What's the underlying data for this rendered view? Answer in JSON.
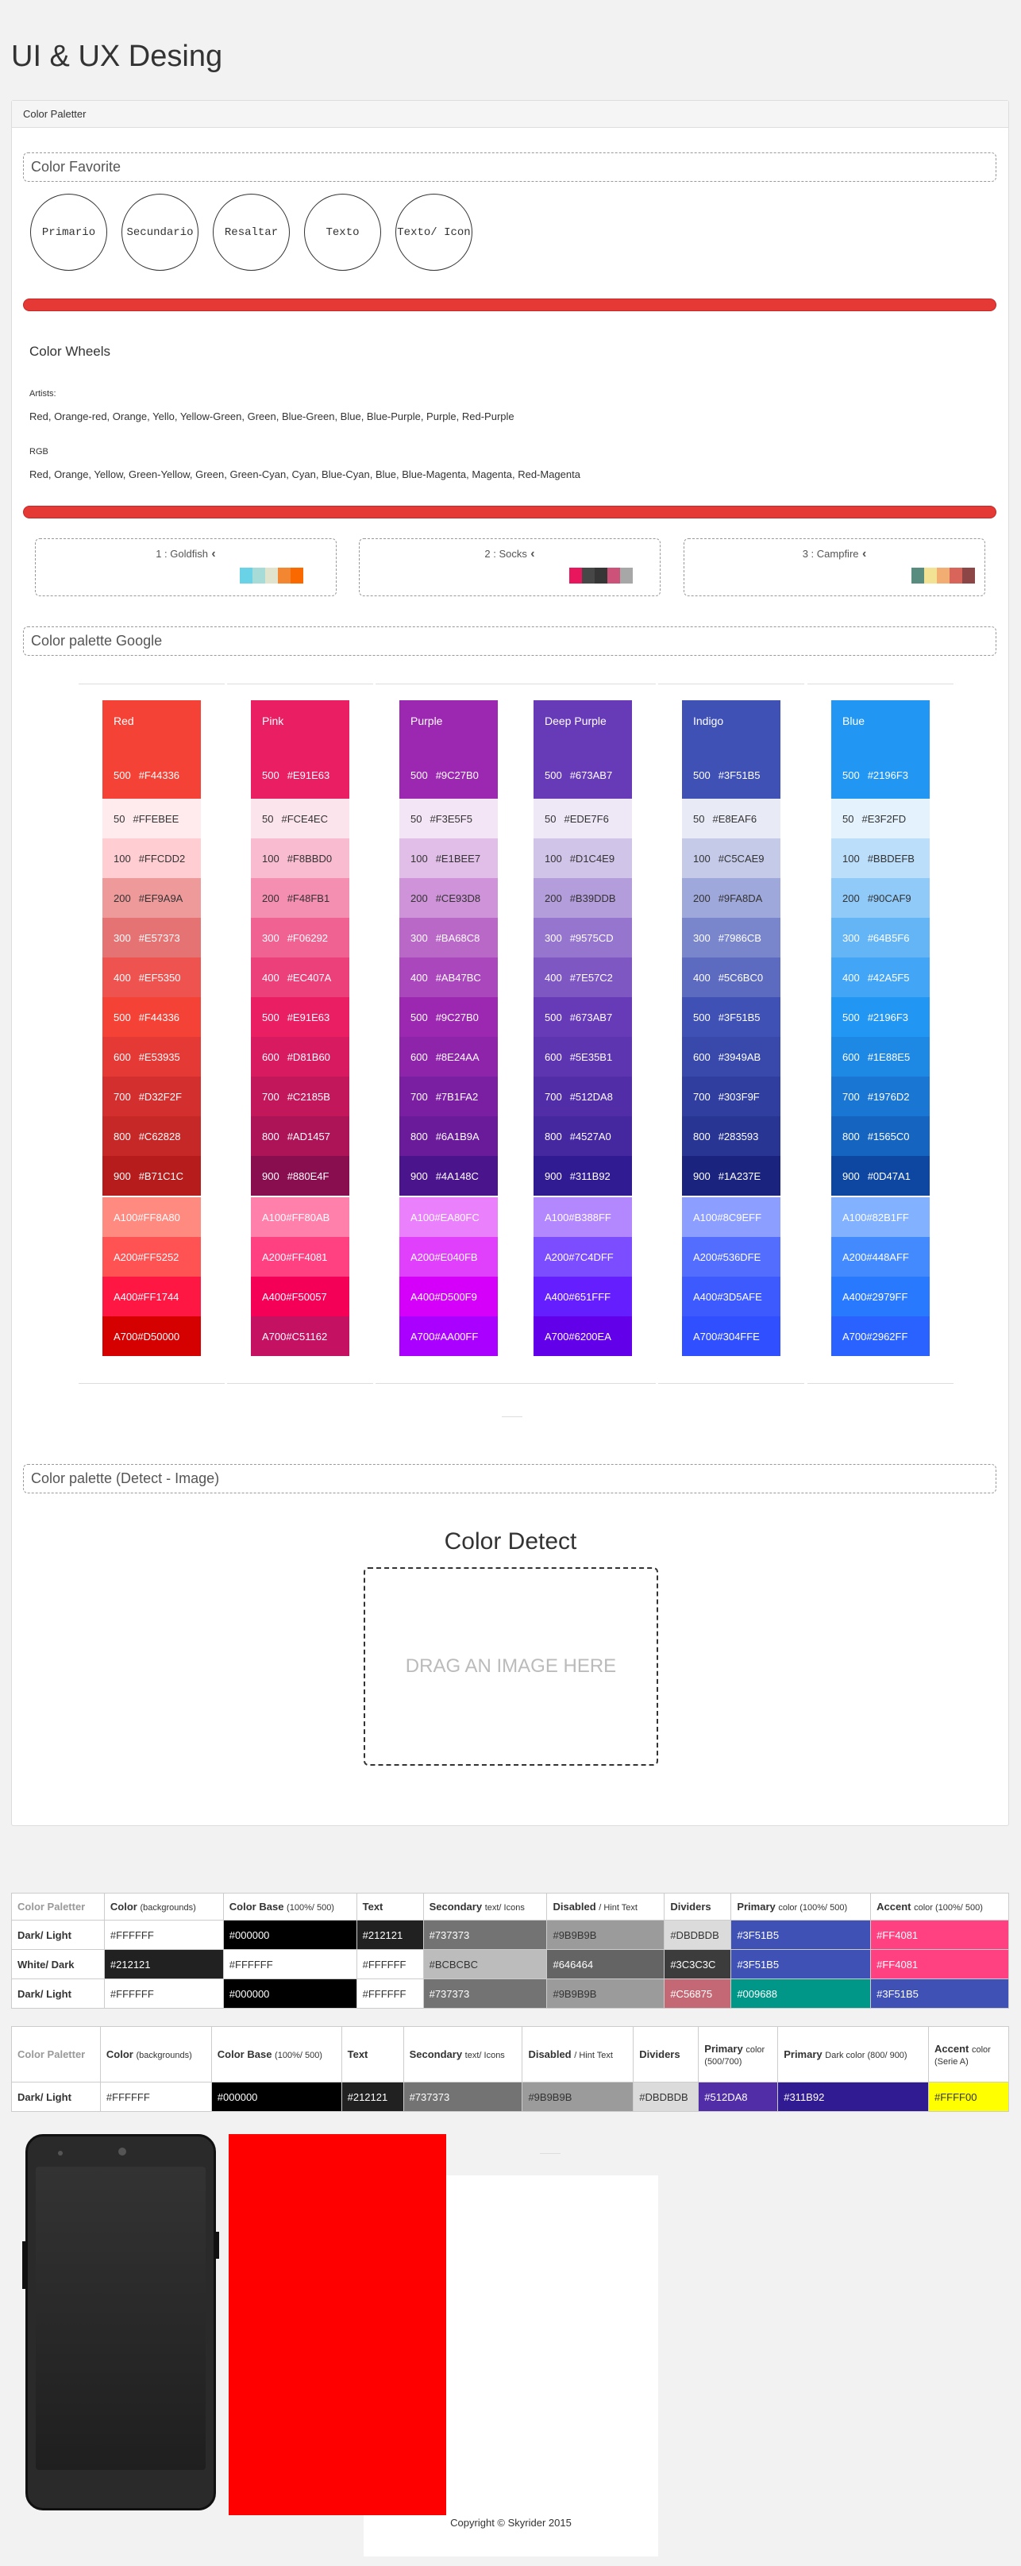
{
  "page": {
    "title": "UI & UX Desing",
    "panel_title": "Color Paletter"
  },
  "favorite": {
    "title": "Color Favorite",
    "circles": [
      "Primario",
      "Secundario",
      "Resaltar",
      "Texto",
      "Texto/ Icon"
    ]
  },
  "wheels": {
    "title": "Color Wheels",
    "artists_label": "Artists:",
    "artists_text": "Red, Orange-red, Orange, Yello, Yellow-Green, Green, Blue-Green, Blue, Blue-Purple, Purple, Red-Purple",
    "rgb_label": "RGB",
    "rgb_text": "Red, Orange, Yellow, Green-Yellow, Green, Green-Cyan, Cyan, Blue-Cyan, Blue, Blue-Magenta, Magenta, Red-Magenta"
  },
  "palettes": [
    {
      "label": "1 : Goldfish",
      "colors": [
        "#69D2E7",
        "#A7DBD8",
        "#E0E4CC",
        "#F38630",
        "#FA6900"
      ]
    },
    {
      "label": "2 : Socks",
      "colors": [
        "#E8175D",
        "#474747",
        "#363636",
        "#CC527A",
        "#A8A7A7"
      ]
    },
    {
      "label": "3 : Campfire",
      "colors": [
        "#588C7E",
        "#F2E394",
        "#F2AE72",
        "#D96459",
        "#8C4646"
      ]
    }
  ],
  "google": {
    "title": "Color palette Google",
    "columns": [
      {
        "name": "Red",
        "base": "#F44336",
        "shades": [
          [
            "500",
            "#F44336"
          ],
          [
            "50",
            "#FFEBEE"
          ],
          [
            "100",
            "#FFCDD2"
          ],
          [
            "200",
            "#EF9A9A"
          ],
          [
            "300",
            "#E57373"
          ],
          [
            "400",
            "#EF5350"
          ],
          [
            "500",
            "#F44336"
          ],
          [
            "600",
            "#E53935"
          ],
          [
            "700",
            "#D32F2F"
          ],
          [
            "800",
            "#C62828"
          ],
          [
            "900",
            "#B71C1C"
          ]
        ],
        "accents": [
          [
            "A100",
            "#FF8A80"
          ],
          [
            "A200",
            "#FF5252"
          ],
          [
            "A400",
            "#FF1744"
          ],
          [
            "A700",
            "#D50000"
          ]
        ]
      },
      {
        "name": "Pink",
        "base": "#E91E63",
        "shades": [
          [
            "500",
            "#E91E63"
          ],
          [
            "50",
            "#FCE4EC"
          ],
          [
            "100",
            "#F8BBD0"
          ],
          [
            "200",
            "#F48FB1"
          ],
          [
            "300",
            "#F06292"
          ],
          [
            "400",
            "#EC407A"
          ],
          [
            "500",
            "#E91E63"
          ],
          [
            "600",
            "#D81B60"
          ],
          [
            "700",
            "#C2185B"
          ],
          [
            "800",
            "#AD1457"
          ],
          [
            "900",
            "#880E4F"
          ]
        ],
        "accents": [
          [
            "A100",
            "#FF80AB"
          ],
          [
            "A200",
            "#FF4081"
          ],
          [
            "A400",
            "#F50057"
          ],
          [
            "A700",
            "#C51162"
          ]
        ]
      },
      {
        "name": "Purple",
        "base": "#9C27B0",
        "shades": [
          [
            "500",
            "#9C27B0"
          ],
          [
            "50",
            "#F3E5F5"
          ],
          [
            "100",
            "#E1BEE7"
          ],
          [
            "200",
            "#CE93D8"
          ],
          [
            "300",
            "#BA68C8"
          ],
          [
            "400",
            "#AB47BC"
          ],
          [
            "500",
            "#9C27B0"
          ],
          [
            "600",
            "#8E24AA"
          ],
          [
            "700",
            "#7B1FA2"
          ],
          [
            "800",
            "#6A1B9A"
          ],
          [
            "900",
            "#4A148C"
          ]
        ],
        "accents": [
          [
            "A100",
            "#EA80FC"
          ],
          [
            "A200",
            "#E040FB"
          ],
          [
            "A400",
            "#D500F9"
          ],
          [
            "A700",
            "#AA00FF"
          ]
        ]
      },
      {
        "name": "Deep Purple",
        "base": "#673AB7",
        "shades": [
          [
            "500",
            "#673AB7"
          ],
          [
            "50",
            "#EDE7F6"
          ],
          [
            "100",
            "#D1C4E9"
          ],
          [
            "200",
            "#B39DDB"
          ],
          [
            "300",
            "#9575CD"
          ],
          [
            "400",
            "#7E57C2"
          ],
          [
            "500",
            "#673AB7"
          ],
          [
            "600",
            "#5E35B1"
          ],
          [
            "700",
            "#512DA8"
          ],
          [
            "800",
            "#4527A0"
          ],
          [
            "900",
            "#311B92"
          ]
        ],
        "accents": [
          [
            "A100",
            "#B388FF"
          ],
          [
            "A200",
            "#7C4DFF"
          ],
          [
            "A400",
            "#651FFF"
          ],
          [
            "A700",
            "#6200EA"
          ]
        ]
      },
      {
        "name": "Indigo",
        "base": "#3F51B5",
        "shades": [
          [
            "500",
            "#3F51B5"
          ],
          [
            "50",
            "#E8EAF6"
          ],
          [
            "100",
            "#C5CAE9"
          ],
          [
            "200",
            "#9FA8DA"
          ],
          [
            "300",
            "#7986CB"
          ],
          [
            "400",
            "#5C6BC0"
          ],
          [
            "500",
            "#3F51B5"
          ],
          [
            "600",
            "#3949AB"
          ],
          [
            "700",
            "#303F9F"
          ],
          [
            "800",
            "#283593"
          ],
          [
            "900",
            "#1A237E"
          ]
        ],
        "accents": [
          [
            "A100",
            "#8C9EFF"
          ],
          [
            "A200",
            "#536DFE"
          ],
          [
            "A400",
            "#3D5AFE"
          ],
          [
            "A700",
            "#304FFE"
          ]
        ]
      },
      {
        "name": "Blue",
        "base": "#2196F3",
        "shades": [
          [
            "500",
            "#2196F3"
          ],
          [
            "50",
            "#E3F2FD"
          ],
          [
            "100",
            "#BBDEFB"
          ],
          [
            "200",
            "#90CAF9"
          ],
          [
            "300",
            "#64B5F6"
          ],
          [
            "400",
            "#42A5F5"
          ],
          [
            "500",
            "#2196F3"
          ],
          [
            "600",
            "#1E88E5"
          ],
          [
            "700",
            "#1976D2"
          ],
          [
            "800",
            "#1565C0"
          ],
          [
            "900",
            "#0D47A1"
          ]
        ],
        "accents": [
          [
            "A100",
            "#82B1FF"
          ],
          [
            "A200",
            "#448AFF"
          ],
          [
            "A400",
            "#2979FF"
          ],
          [
            "A700",
            "#2962FF"
          ]
        ]
      }
    ]
  },
  "detect": {
    "section_title": "Color palette (Detect - Image)",
    "title": "Color Detect",
    "drop_text": "DRAG AN IMAGE HERE"
  },
  "table1": {
    "headers": [
      {
        "main": "Color Paletter",
        "sub": ""
      },
      {
        "main": "Color",
        "sub": "(backgrounds)"
      },
      {
        "main": "Color Base",
        "sub": "(100%/ 500)"
      },
      {
        "main": "Text",
        "sub": ""
      },
      {
        "main": "Secondary",
        "sub": "text/ Icons"
      },
      {
        "main": "Disabled",
        "sub": "/ Hint Text"
      },
      {
        "main": "Dividers",
        "sub": ""
      },
      {
        "main": "Primary",
        "sub": "color (100%/ 500)"
      },
      {
        "main": "Accent",
        "sub": "color (100%/ 500)"
      }
    ],
    "rows": [
      {
        "cells": [
          "Dark/ Light",
          "#FFFFFF",
          "#000000",
          "#212121",
          "#737373",
          "#9B9B9B",
          "#DBDBDB",
          "#3F51B5",
          "#FF4081"
        ],
        "bgs": [
          "#fff",
          "#fff",
          "#000000",
          "#212121",
          "#737373",
          "#9B9B9B",
          "#DBDBDB",
          "#3F51B5",
          "#FF4081"
        ]
      },
      {
        "cells": [
          "White/ Dark",
          "#212121",
          "#FFFFFF",
          "#FFFFFF",
          "#BCBCBC",
          "#646464",
          "#3C3C3C",
          "#3F51B5",
          "#FF4081"
        ],
        "bgs": [
          "#fff",
          "#212121",
          "#FFFFFF",
          "#FFFFFF",
          "#BCBCBC",
          "#646464",
          "#3C3C3C",
          "#3F51B5",
          "#FF4081"
        ]
      },
      {
        "cells": [
          "Dark/ Light",
          "#FFFFFF",
          "#000000",
          "#FFFFFF",
          "#737373",
          "#9B9B9B",
          "#C56875",
          "#009688",
          "#3F51B5"
        ],
        "bgs": [
          "#fff",
          "#FFFFFF",
          "#000000",
          "#FFFFFF",
          "#737373",
          "#9B9B9B",
          "#C56875",
          "#009688",
          "#3F51B5"
        ]
      }
    ]
  },
  "table2": {
    "headers": [
      {
        "main": "Color Paletter",
        "sub": ""
      },
      {
        "main": "Color",
        "sub": "(backgrounds)"
      },
      {
        "main": "Color Base",
        "sub": "(100%/ 500)"
      },
      {
        "main": "Text",
        "sub": ""
      },
      {
        "main": "Secondary",
        "sub": "text/ Icons"
      },
      {
        "main": "Disabled",
        "sub": "/ Hint Text"
      },
      {
        "main": "Dividers",
        "sub": ""
      },
      {
        "main": "Primary",
        "sub": "color (500/700)"
      },
      {
        "main": "Primary",
        "sub": "Dark color (800/ 900)"
      },
      {
        "main": "Accent",
        "sub": "color (Serie A)"
      }
    ],
    "rows": [
      {
        "cells": [
          "Dark/ Light",
          "#FFFFFF",
          "#000000",
          "#212121",
          "#737373",
          "#9B9B9B",
          "#DBDBDB",
          "#512DA8",
          "#311B92",
          "#FFFF00"
        ],
        "bgs": [
          "#fff",
          "#FFFFFF",
          "#000000",
          "#212121",
          "#737373",
          "#9B9B9B",
          "#DBDBDB",
          "#512DA8",
          "#311B92",
          "#FFFF00"
        ]
      }
    ]
  },
  "footer": {
    "copyright": "Copyright © Skyrider 2015"
  }
}
